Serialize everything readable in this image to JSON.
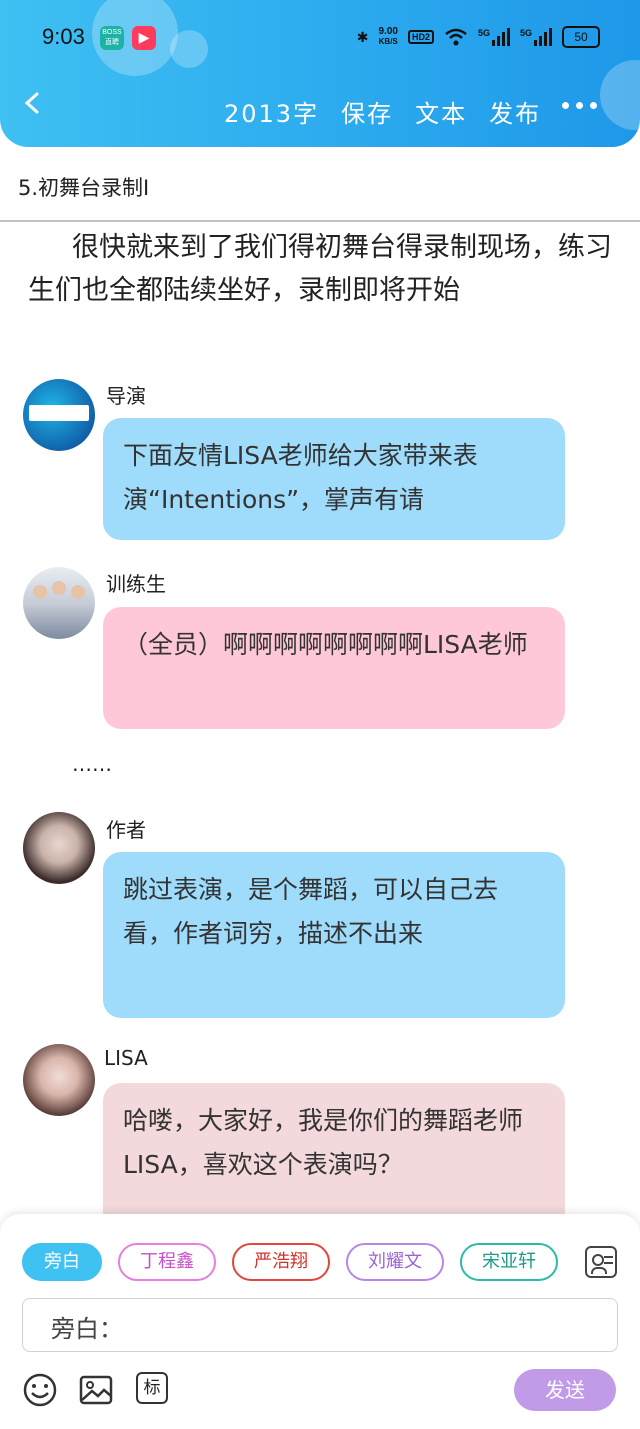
{
  "status_bar": {
    "time": "9:03",
    "app1_label_top": "BOSS",
    "app1_label_bottom": "直聘",
    "net_speed_top": "9.00",
    "net_speed_bottom": "KB/S",
    "hd": "HD2",
    "sig1": "5G",
    "sig2": "5G",
    "battery": "50"
  },
  "toolbar": {
    "word_count": "2013字",
    "save": "保存",
    "text": "文本",
    "publish": "发布"
  },
  "chapter_title": "5.初舞台录制Ⅰ",
  "narration": "很快就来到了我们得初舞台得录制现场，练习生们也全都陆续坐好，录制即将开始",
  "messages": [
    {
      "name": "导演",
      "text": "下面友情LISA老师给大家带来表演“Intentions”，掌声有请"
    },
    {
      "name": "训练生",
      "text": "（全员）啊啊啊啊啊啊啊啊LISA老师"
    },
    {
      "name": "作者",
      "text": "跳过表演，是个舞蹈，可以自己去看，作者词穷，描述不出来"
    },
    {
      "name": "LISA",
      "text": "哈喽，大家好，我是你们的舞蹈老师LISA，喜欢这个表演吗？"
    }
  ],
  "ellipsis": "……",
  "chips": [
    "旁白",
    "丁程鑫",
    "严浩翔",
    "刘耀文",
    "宋亚轩"
  ],
  "chip_colors": [
    "#3fc2f1",
    "#e77ee0",
    "#e4453f",
    "#b986e6",
    "#2dbba4"
  ],
  "input_prefix": "旁白：",
  "tool_label": "标",
  "send_label": "发送"
}
